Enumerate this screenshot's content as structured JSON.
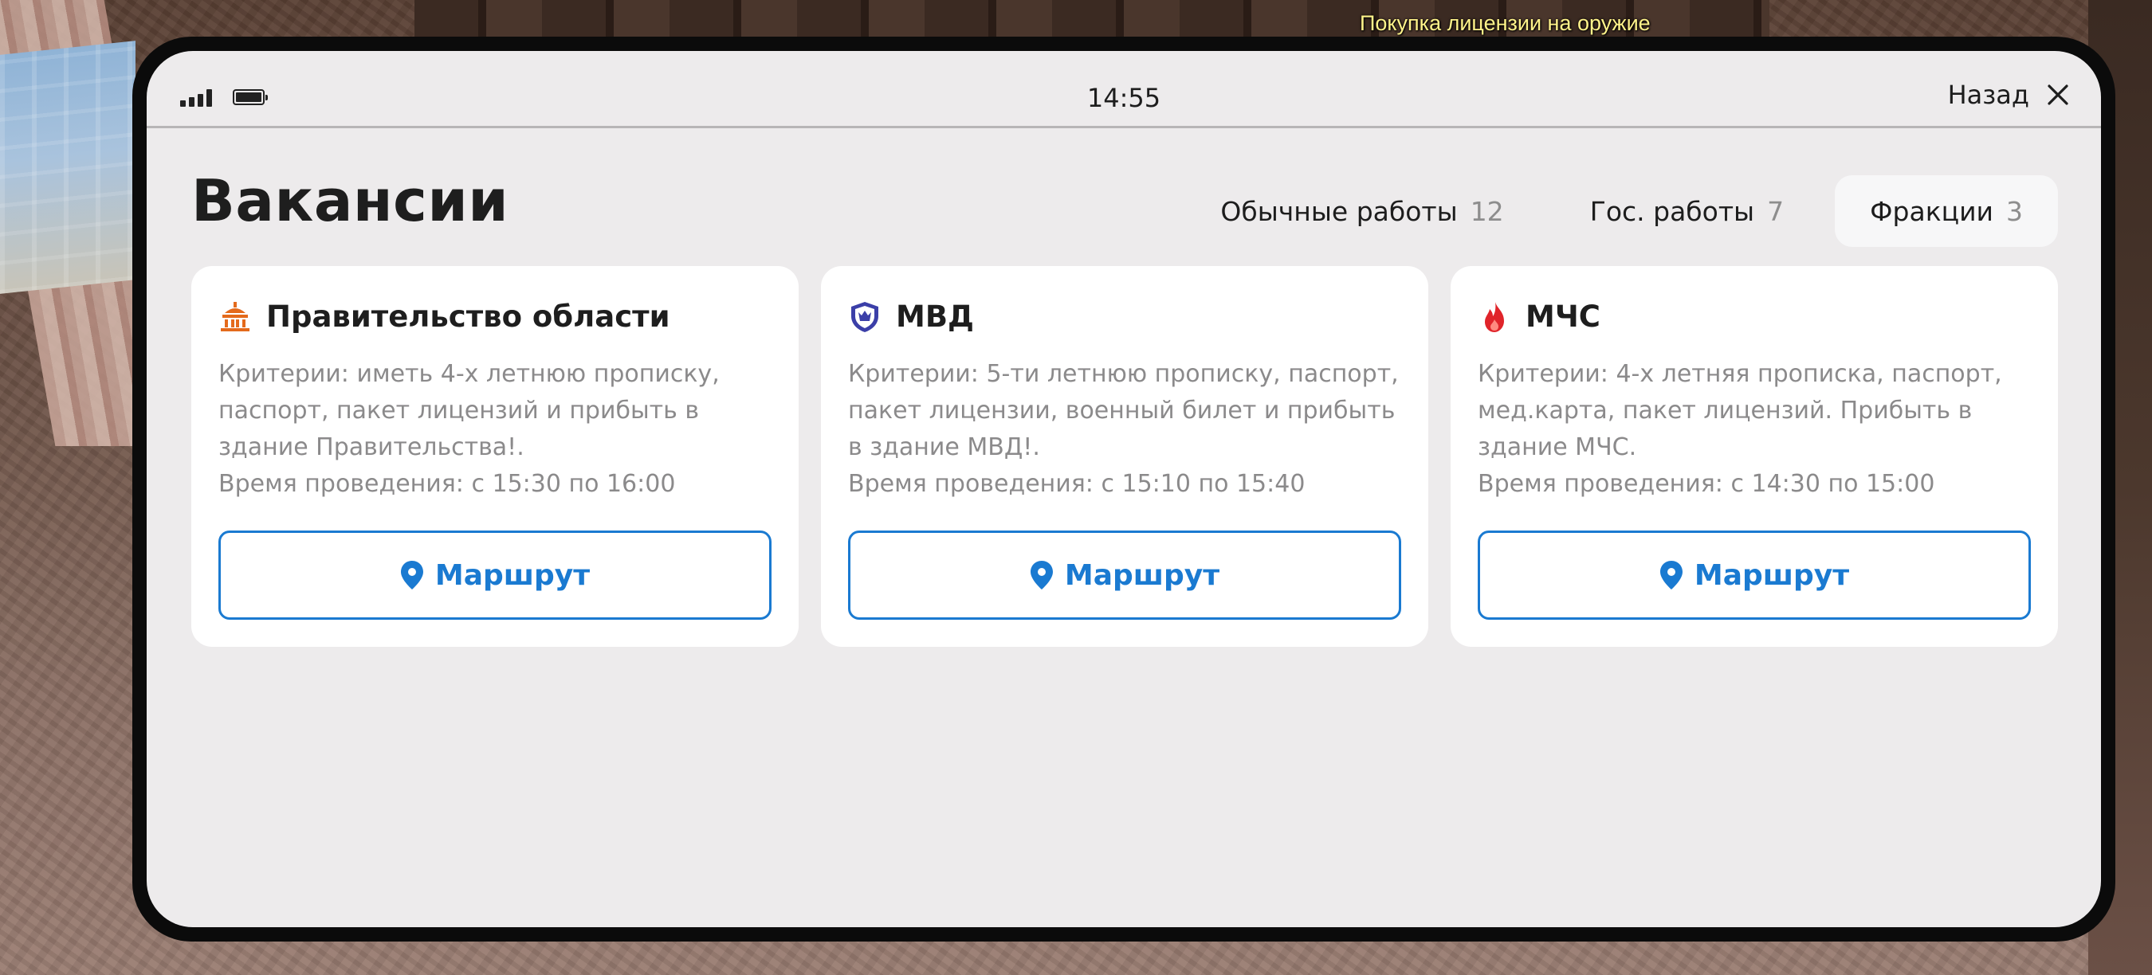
{
  "game": {
    "hint_text": "Покупка лицензии на оружие"
  },
  "status_bar": {
    "time": "14:55",
    "back_label": "Назад",
    "signal_icon": "signal-icon",
    "battery_icon": "battery-icon",
    "close_icon": "close-icon"
  },
  "page": {
    "title": "Вакансии"
  },
  "tabs": [
    {
      "label": "Обычные работы",
      "count": "12",
      "active": false
    },
    {
      "label": "Гос. работы",
      "count": "7",
      "active": false
    },
    {
      "label": "Фракции",
      "count": "3",
      "active": true
    }
  ],
  "cards": [
    {
      "icon": "government-building-icon",
      "icon_color": "#e46a1c",
      "title": "Правительство области",
      "criteria": "Критерии: иметь 4-х летнюю прописку, паспорт, пакет лицензий и прибыть в здание Правительства!.",
      "time": "Время проведения: с 15:30 по 16:00",
      "button_label": "Маршрут"
    },
    {
      "icon": "police-shield-icon",
      "icon_color": "#3b3fa8",
      "title": "МВД",
      "criteria": "Критерии: 5-ти летнюю прописку, паспорт, пакет лицензии, военный билет и прибыть в здание МВД!.",
      "time": "Время проведения: с 15:10 по 15:40",
      "button_label": "Маршрут"
    },
    {
      "icon": "fire-flame-icon",
      "icon_color": "#e0242a",
      "title": "МЧС",
      "criteria": "Критерии: 4-х летняя прописка, паспорт, мед.карта, пакет лицензий. Прибыть в здание МЧС.",
      "time": "Время проведения: с 14:30 по 15:00",
      "button_label": "Маршрут"
    }
  ],
  "colors": {
    "accent": "#1a7ad1",
    "screen_bg": "#edebec",
    "card_bg": "#ffffff",
    "muted_text": "#8b8a8b"
  }
}
